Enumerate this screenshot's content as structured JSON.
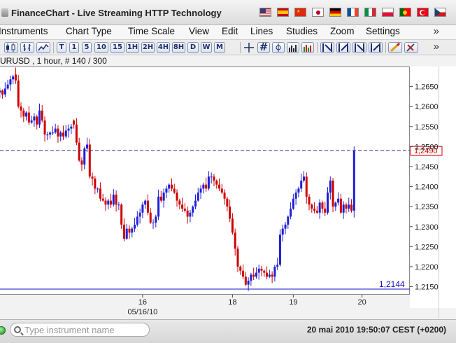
{
  "window": {
    "title": "FinanceChart - Live Streaming HTTP Technology"
  },
  "menu": [
    "Instruments",
    "Chart Type",
    "Time Scale",
    "View",
    "Edit",
    "Lines",
    "Studies",
    "Zoom",
    "Settings"
  ],
  "menu_more": "»",
  "toolbar": {
    "timeframes": [
      "T",
      "1",
      "5",
      "10",
      "15",
      "1H",
      "2H",
      "4H",
      "8H",
      "D",
      "W",
      "M"
    ],
    "grid_glyph": "#",
    "more": "»"
  },
  "chart_info": "EURUSD , 1 hour, # 140 / 300",
  "search": {
    "placeholder": "Type instrument name"
  },
  "status": {
    "datetime": "20 mai 2010 19:50:07  CEST (+0200)"
  },
  "colors": {
    "up": "#1f1fd6",
    "down": "#d00000",
    "last_price_line": "#2a2a9a",
    "last_price_box": "#cc0000",
    "support_line": "#1010c0"
  },
  "chart_data": {
    "type": "candlestick",
    "instrument": "EURUSD",
    "timeframe": "1 hour",
    "ylim": [
      1.213,
      1.27
    ],
    "y_ticks": [
      "1,2150",
      "1,2200",
      "1,2250",
      "1,2300",
      "1,2350",
      "1,2400",
      "1,2450",
      "1,2500",
      "1,2550",
      "1,2600",
      "1,2650"
    ],
    "y_tick_values": [
      1.215,
      1.22,
      1.225,
      1.23,
      1.235,
      1.24,
      1.245,
      1.25,
      1.255,
      1.26,
      1.265
    ],
    "x_ticks": [
      {
        "label": "16",
        "sublabel": "05/16/10",
        "at_candle": 55
      },
      {
        "label": "18",
        "sublabel": "",
        "at_candle": 89
      },
      {
        "label": "19",
        "sublabel": "",
        "at_candle": 112
      },
      {
        "label": "20",
        "sublabel": "",
        "at_candle": 138
      }
    ],
    "last_price": {
      "value": 1.249,
      "label": "1,2490",
      "style": "dashed"
    },
    "support_level": {
      "value": 1.2144,
      "label": "1,2144",
      "style": "solid"
    },
    "grid": false,
    "closes": [
      1.2635,
      1.264,
      1.263,
      1.2645,
      1.2655,
      1.2668,
      1.2675,
      1.2665,
      1.26,
      1.259,
      1.2575,
      1.2585,
      1.256,
      1.2565,
      1.2575,
      1.2555,
      1.259,
      1.2565,
      1.253,
      1.253,
      1.2535,
      1.2535,
      1.2545,
      1.2525,
      1.2535,
      1.2525,
      1.254,
      1.2545,
      1.255,
      1.2555,
      1.251,
      1.2465,
      1.2455,
      1.2495,
      1.2505,
      1.2425,
      1.242,
      1.2395,
      1.2395,
      1.237,
      1.2365,
      1.2355,
      1.2365,
      1.2355,
      1.238,
      1.2355,
      1.2355,
      1.2305,
      1.227,
      1.2295,
      1.2285,
      1.2295,
      1.2305,
      1.2325,
      1.2335,
      1.2355,
      1.2365,
      1.2335,
      1.231,
      1.231,
      1.2325,
      1.2375,
      1.2365,
      1.2385,
      1.2395,
      1.2405,
      1.2395,
      1.2385,
      1.2365,
      1.2355,
      1.2345,
      1.234,
      1.2325,
      1.2335,
      1.235,
      1.2365,
      1.2385,
      1.2395,
      1.2405,
      1.2395,
      1.2425,
      1.2425,
      1.2415,
      1.2405,
      1.2395,
      1.2385,
      1.237,
      1.235,
      1.232,
      1.2285,
      1.2245,
      1.22,
      1.219,
      1.2175,
      1.2155,
      1.2165,
      1.218,
      1.2175,
      1.2185,
      1.2195,
      1.219,
      1.2185,
      1.2175,
      1.218,
      1.2175,
      1.22,
      1.2205,
      1.228,
      1.2295,
      1.2305,
      1.2325,
      1.2345,
      1.237,
      1.2385,
      1.2395,
      1.2415,
      1.2425,
      1.2375,
      1.2355,
      1.2345,
      1.234,
      1.2335,
      1.236,
      1.2345,
      1.2335,
      1.2385,
      1.2415,
      1.235,
      1.236,
      1.237,
      1.2335,
      1.2355,
      1.2345,
      1.2355,
      1.234,
      1.249
    ],
    "opens": [
      1.2625,
      1.2635,
      1.264,
      1.263,
      1.2645,
      1.2655,
      1.2668,
      1.268,
      1.2665,
      1.26,
      1.259,
      1.2575,
      1.2585,
      1.256,
      1.2565,
      1.2575,
      1.2555,
      1.259,
      1.2565,
      1.253,
      1.253,
      1.2535,
      1.2535,
      1.2545,
      1.2525,
      1.2535,
      1.2525,
      1.254,
      1.2545,
      1.2565,
      1.2555,
      1.251,
      1.2465,
      1.2455,
      1.2495,
      1.2505,
      1.2425,
      1.242,
      1.2395,
      1.2395,
      1.237,
      1.2365,
      1.2355,
      1.2365,
      1.2355,
      1.238,
      1.2355,
      1.2355,
      1.2305,
      1.227,
      1.2295,
      1.2285,
      1.2295,
      1.2305,
      1.2325,
      1.2335,
      1.2355,
      1.2365,
      1.2335,
      1.231,
      1.231,
      1.2325,
      1.2375,
      1.2365,
      1.2385,
      1.2395,
      1.2405,
      1.2395,
      1.2385,
      1.2365,
      1.2355,
      1.2345,
      1.234,
      1.2325,
      1.2335,
      1.235,
      1.2365,
      1.2385,
      1.2395,
      1.2405,
      1.2395,
      1.2425,
      1.2425,
      1.2415,
      1.2405,
      1.2395,
      1.2385,
      1.237,
      1.235,
      1.232,
      1.2285,
      1.2245,
      1.22,
      1.219,
      1.2175,
      1.2155,
      1.2165,
      1.218,
      1.2175,
      1.2185,
      1.2195,
      1.219,
      1.2185,
      1.2175,
      1.218,
      1.2175,
      1.22,
      1.2205,
      1.228,
      1.2295,
      1.2305,
      1.2325,
      1.2345,
      1.237,
      1.2385,
      1.2395,
      1.2415,
      1.2425,
      1.2375,
      1.2355,
      1.2345,
      1.234,
      1.2335,
      1.236,
      1.2345,
      1.2335,
      1.2385,
      1.2415,
      1.235,
      1.236,
      1.237,
      1.2335,
      1.2355,
      1.2345,
      1.2355,
      1.234
    ]
  }
}
